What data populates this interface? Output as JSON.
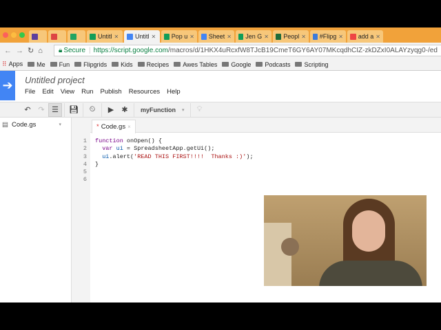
{
  "browser": {
    "tabs": [
      {
        "label": "",
        "color": "#5b3f9e"
      },
      {
        "label": "",
        "color": "#d44"
      },
      {
        "label": "",
        "color": "#1fa463"
      },
      {
        "label": "Untitl",
        "color": "#0f9d58"
      },
      {
        "label": "Untitl",
        "color": "#4285f4",
        "active": true
      },
      {
        "label": "Pop u",
        "color": "#0f9d58"
      },
      {
        "label": "Sheet",
        "color": "#4285f4"
      },
      {
        "label": "Jen G",
        "color": "#0f9d58"
      },
      {
        "label": "Peopl",
        "color": "#1e6b3a"
      },
      {
        "label": "#Flipg",
        "color": "#3b7bdc"
      },
      {
        "label": "add a",
        "color": "#e44"
      }
    ],
    "secure_label": "Secure",
    "url_host": "https://script.google.com",
    "url_path": "/macros/d/1HKX4uRcxfW8TJcB19CmeT6GY6AY07MKcqdhCIZ-zkDZxI0ALAYzyqg0-/ed",
    "bookmarks": [
      "Apps",
      "Me",
      "Fun",
      "Flipgrids",
      "Kids",
      "Recipes",
      "Awes Tables",
      "Google",
      "Podcasts",
      "Scripting"
    ]
  },
  "app": {
    "project_title": "Untitled project",
    "menu": [
      "File",
      "Edit",
      "View",
      "Run",
      "Publish",
      "Resources",
      "Help"
    ],
    "function_select": "myFunction",
    "file_name": "Code.gs",
    "editor_tab": "Code.gs",
    "modified_marker": "*",
    "code": [
      {
        "n": "1",
        "text": "function onOpen() {"
      },
      {
        "n": "2",
        "text": "  var ui = SpreadsheetApp.getUi();"
      },
      {
        "n": "3",
        "text": "  ui.alert('READ THIS FIRST!!!!  Thanks :)');"
      },
      {
        "n": "4",
        "text": "}"
      },
      {
        "n": "5",
        "text": ""
      },
      {
        "n": "6",
        "text": ""
      }
    ]
  }
}
